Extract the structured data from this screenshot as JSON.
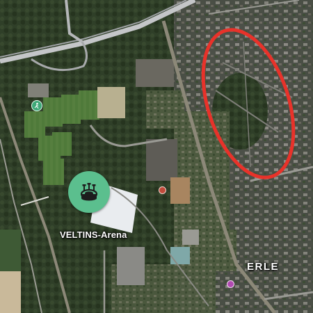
{
  "map": {
    "type": "satellite",
    "labels": {
      "arena": "VELTINS-Arena",
      "district": "ERLE"
    },
    "markers": {
      "arena": {
        "icon": "stadium-icon",
        "color": "#5bbf8e"
      },
      "sport": {
        "icon": "sports-icon",
        "color": "#3fa878"
      },
      "poi_1": {
        "icon": "poi-marker-icon",
        "color": "#b04ab0"
      },
      "poi_2": {
        "icon": "poi-marker-icon",
        "color": "#c04a3a"
      }
    },
    "highlight": {
      "shape": "ellipse",
      "color": "#e8322a"
    }
  }
}
